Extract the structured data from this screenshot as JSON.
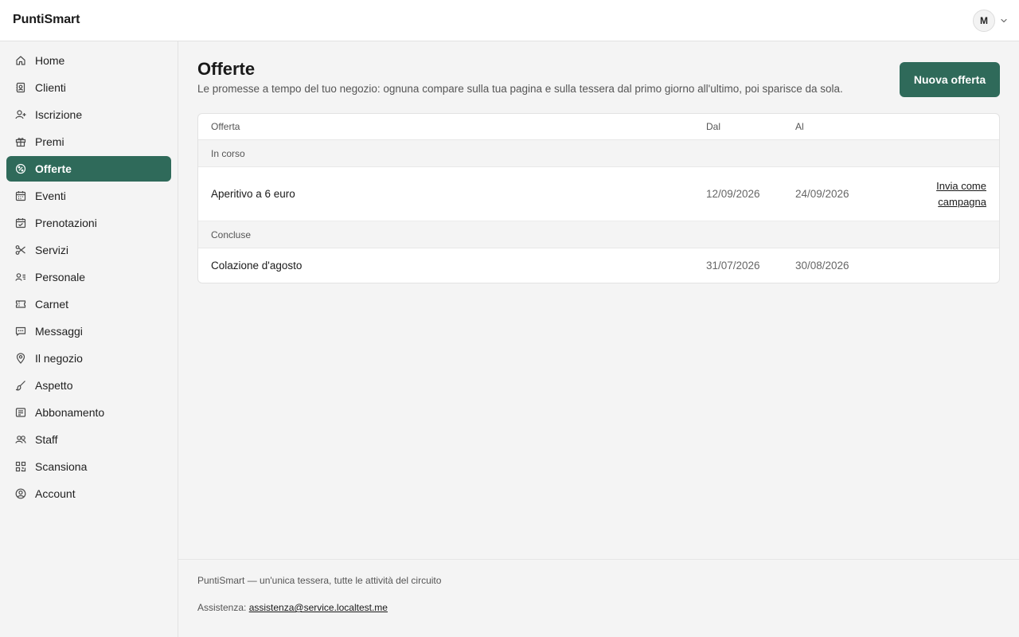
{
  "app": {
    "brand": "PuntiSmart"
  },
  "user": {
    "initial": "M"
  },
  "sidebar": {
    "items": [
      {
        "label": "Home",
        "icon": "home-icon"
      },
      {
        "label": "Clienti",
        "icon": "contacts-icon"
      },
      {
        "label": "Iscrizione",
        "icon": "user-plus-icon"
      },
      {
        "label": "Premi",
        "icon": "gift-icon"
      },
      {
        "label": "Offerte",
        "icon": "discount-icon",
        "active": true
      },
      {
        "label": "Eventi",
        "icon": "calendar-icon"
      },
      {
        "label": "Prenotazioni",
        "icon": "calendar-check-icon"
      },
      {
        "label": "Servizi",
        "icon": "scissors-icon"
      },
      {
        "label": "Personale",
        "icon": "user-list-icon"
      },
      {
        "label": "Carnet",
        "icon": "ticket-icon"
      },
      {
        "label": "Messaggi",
        "icon": "message-icon"
      },
      {
        "label": "Il negozio",
        "icon": "map-pin-icon"
      },
      {
        "label": "Aspetto",
        "icon": "paintbrush-icon"
      },
      {
        "label": "Abbonamento",
        "icon": "receipt-icon"
      },
      {
        "label": "Staff",
        "icon": "users-icon"
      },
      {
        "label": "Scansiona",
        "icon": "qr-code-icon"
      },
      {
        "label": "Account",
        "icon": "user-circle-icon"
      }
    ]
  },
  "page": {
    "title": "Offerte",
    "description": "Le promesse a tempo del tuo negozio: ognuna compare sulla tua pagina e sulla tessera dal primo giorno all'ultimo, poi sparisce da sola.",
    "new_button": "Nuova offerta"
  },
  "table": {
    "headers": {
      "offer": "Offerta",
      "from": "Dal",
      "to": "Al"
    },
    "groups": [
      {
        "label": "In corso",
        "rows": [
          {
            "name": "Aperitivo a 6 euro",
            "from": "12/09/2026",
            "to": "24/09/2026",
            "action": "Invia come campagna"
          }
        ]
      },
      {
        "label": "Concluse",
        "rows": [
          {
            "name": "Colazione d'agosto",
            "from": "31/07/2026",
            "to": "30/08/2026"
          }
        ]
      }
    ]
  },
  "footer": {
    "tagline": "PuntiSmart — un'unica tessera, tutte le attività del circuito",
    "support_label": "Assistenza:",
    "support_email": "assistenza@service.localtest.me"
  },
  "colors": {
    "accent": "#2f6a5a"
  }
}
